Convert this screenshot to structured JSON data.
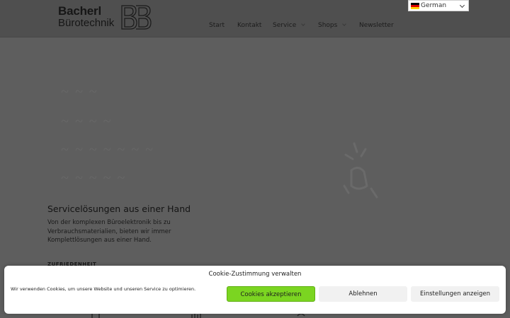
{
  "logo": {
    "line1": "Bacherl",
    "line2": "Bürotechnik",
    "mark": "BB"
  },
  "nav": {
    "items": [
      {
        "label": "Start",
        "has_dropdown": false
      },
      {
        "label": "Kontakt",
        "has_dropdown": false
      },
      {
        "label": "Service",
        "has_dropdown": true
      },
      {
        "label": "Shops",
        "has_dropdown": true
      },
      {
        "label": "Newsletter",
        "has_dropdown": false
      }
    ]
  },
  "language": {
    "selected": "German",
    "icon": "flag-de-icon"
  },
  "service": {
    "title": "Servicelösungen aus einer Hand",
    "text": "Von der komplexen Büroelektronik bis zu Verbrauchsmaterialien, bieten wir immer Komplettlösungen aus einer Hand.",
    "section_label": "ZUFRIEDENHEIT"
  },
  "cookie": {
    "title": "Cookie-Zustimmung verwalten",
    "text": "Wir verwenden Cookies, um unsere Website und unseren Service zu optimieren.",
    "accept_label": "Cookies akzeptieren",
    "deny_label": "Ablehnen",
    "prefs_label": "Einstellungen anzeigen"
  },
  "colors": {
    "accept_button": "#7bd521",
    "overlay": "#5e5e5e",
    "header": "#4f4f4f"
  }
}
